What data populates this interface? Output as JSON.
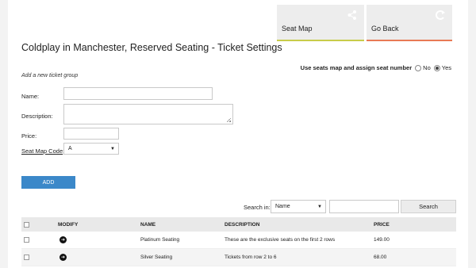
{
  "tiles": {
    "seat_map": "Seat Map",
    "go_back": "Go Back"
  },
  "page_title": "Coldplay in Manchester, Reserved Seating - Ticket Settings",
  "seatmap_option": {
    "label": "Use seats map and assign seat number",
    "no": "No",
    "yes": "Yes",
    "selected": "Yes"
  },
  "form": {
    "subheading": "Add a new ticket group",
    "name_label": "Name:",
    "description_label": "Description:",
    "price_label": "Price:",
    "seat_map_code_label": "Seat Map Code",
    "seat_map_code_colon": ":",
    "seat_map_code_value": "A",
    "add_button": "ADD"
  },
  "search": {
    "label": "Search in:",
    "field_value": "Name",
    "button": "Search"
  },
  "table": {
    "headers": {
      "modify": "MODIFY",
      "name": "NAME",
      "description": "DESCRIPTION",
      "price": "PRICE"
    },
    "rows": [
      {
        "name": "Platinum Seating",
        "description": "These are the exclusive seats on the first 2 rows",
        "price": "149.00"
      },
      {
        "name": "Silver Seating",
        "description": "Tickets from row 2 to 6",
        "price": "68.00"
      }
    ]
  },
  "icons": {
    "seat_map": "share-nodes-icon",
    "go_back": "circular-arrow-icon",
    "modify": "arrow-right-circle-icon"
  },
  "colors": {
    "seat_map_accent": "#c8cc4a",
    "go_back_accent": "#e87a55",
    "add_button": "#3b88c9"
  }
}
